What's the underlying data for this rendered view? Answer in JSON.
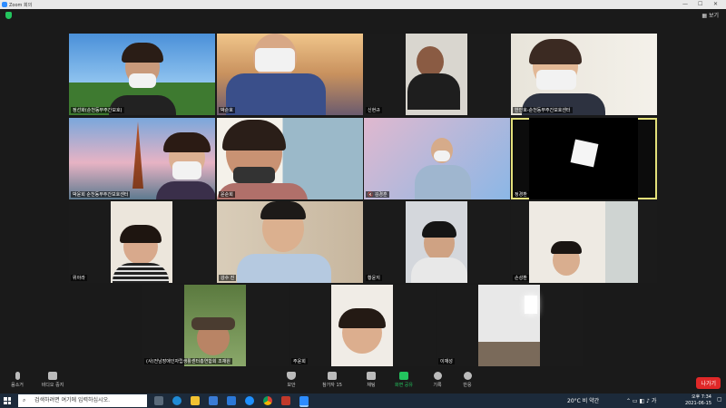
{
  "window": {
    "app_title": "Zoom 회의"
  },
  "topbar": {
    "view_label": "보기"
  },
  "participants": [
    "정선화(순천동부주간보호)",
    "박순호",
    "신현규",
    "한인호-순천동부주간보호센터",
    "박윤희 순천동부주간보호센터",
    "윤순희",
    "김경훈",
    "정경환",
    "위아라",
    "강수 진",
    "황윤지",
    "손성환",
    "(사)전남장애인자립생활센터총연합회 조재원",
    "주윤희",
    "이재성"
  ],
  "toolbar": {
    "mute": "음소거",
    "video": "비디오 중지",
    "security": "보안",
    "participants": "참가자",
    "participants_count": "15",
    "chat": "채팅",
    "share": "화면 공유",
    "record": "기록",
    "reactions": "반응",
    "leave": "나가기"
  },
  "taskbar": {
    "search_placeholder": "검색하려면 여기에 입력하십시오.",
    "weather": "20°C 비 약간",
    "time": "오후 7:34",
    "date": "2021-06-15"
  },
  "colors": {
    "accent": "#2d8cff",
    "active_speaker": "#e3e07a",
    "leave": "#e02828",
    "share": "#23c45e"
  }
}
